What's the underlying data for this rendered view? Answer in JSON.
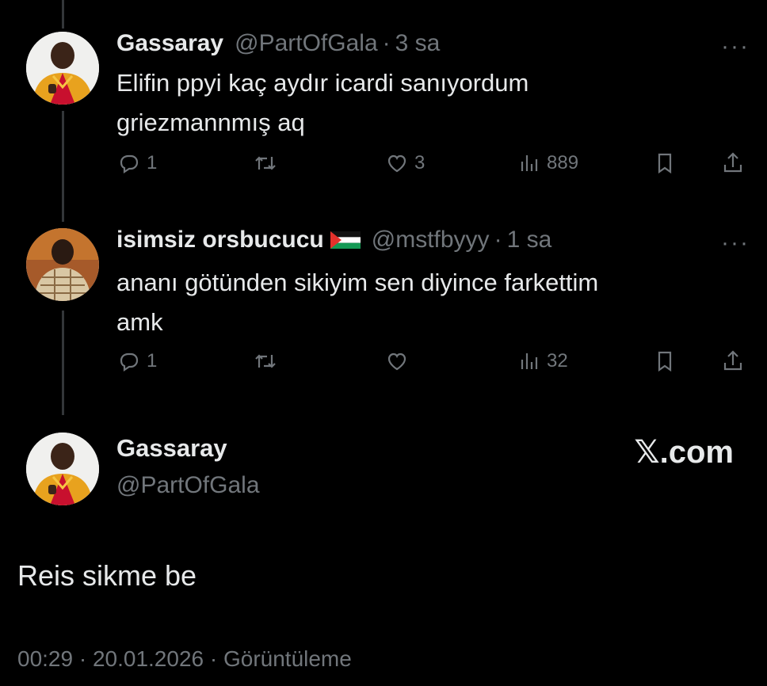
{
  "brand": {
    "site": "𝕏.com"
  },
  "tweets": [
    {
      "name": "Gassaray",
      "handle": "@PartOfGala",
      "time": "3 sa",
      "text_line1": "Elifin ppyi kaç aydır icardi sanıyordum",
      "text_line2": "griezmannmış aq",
      "replies": "1",
      "retweets": "",
      "likes": "3",
      "views": "889"
    },
    {
      "name": "isimsiz orsbucucu",
      "handle": "@mstfbyyy",
      "time": "1 sa",
      "text_line1": "ananı götünden sikiyim sen diyince farkettim",
      "text_line2": "amk",
      "replies": "1",
      "retweets": "",
      "likes": "",
      "views": "32"
    }
  ],
  "main_tweet": {
    "name": "Gassaray",
    "handle": "@PartOfGala",
    "text": "Reis sikme be",
    "meta": "00:29 · 20.01.2026 · Görüntüleme"
  },
  "sep": "·",
  "more_label": "···",
  "colors": {
    "background": "#000000",
    "text": "#e7e9ea",
    "muted": "#71767b",
    "line": "#333639"
  },
  "icons": [
    "reply-icon",
    "retweet-icon",
    "like-icon",
    "views-icon",
    "bookmark-icon",
    "share-icon",
    "more-icon",
    "palestine-flag-icon"
  ]
}
